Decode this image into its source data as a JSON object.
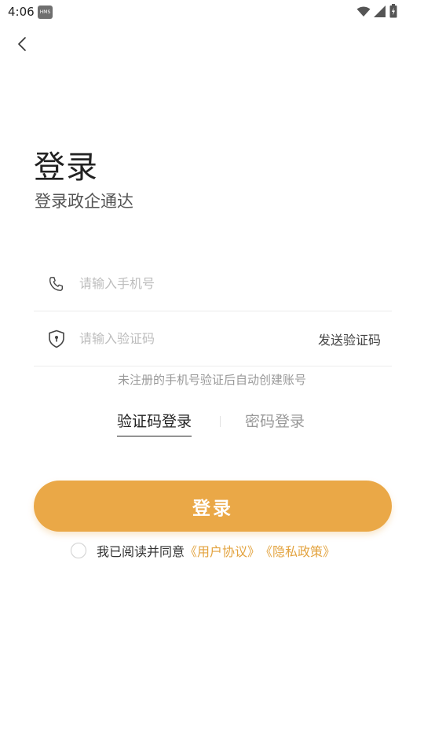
{
  "status_bar": {
    "time": "4:06",
    "badge": "HMS"
  },
  "header": {
    "title": "登录",
    "subtitle": "登录政企通达"
  },
  "form": {
    "phone_placeholder": "请输入手机号",
    "code_placeholder": "请输入验证码",
    "send_code_label": "发送验证码",
    "hint": "未注册的手机号验证后自动创建账号"
  },
  "tabs": {
    "active_label": "验证码登录",
    "inactive_label": "密码登录"
  },
  "login_button_label": "登录",
  "agreement": {
    "prefix": "我已阅读并同意",
    "user_agreement": "《用户协议》",
    "privacy_policy": "《隐私政策》"
  },
  "colors": {
    "accent": "#eaa847",
    "link": "#e3a33f"
  },
  "icons": [
    "back-icon",
    "phone-icon",
    "shield-icon",
    "wifi-icon",
    "signal-icon",
    "battery-icon"
  ]
}
